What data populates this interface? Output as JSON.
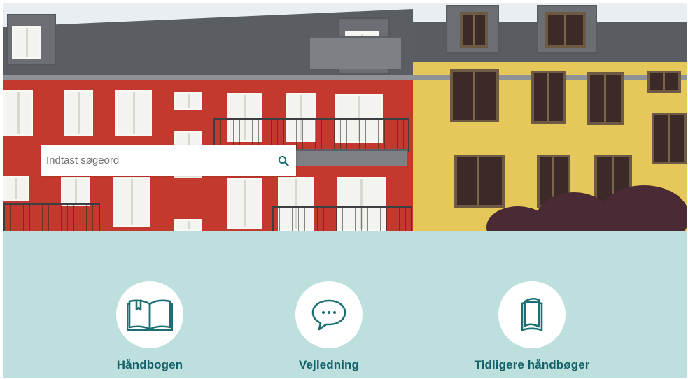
{
  "search": {
    "placeholder": "Indtast søgeord",
    "value": ""
  },
  "tiles": [
    {
      "label": "Håndbogen",
      "icon": "open-book-icon"
    },
    {
      "label": "Vejledning",
      "icon": "chat-bubble-icon"
    },
    {
      "label": "Tidligere håndbøger",
      "icon": "closed-book-icon"
    }
  ],
  "colors": {
    "teal_background": "#bde0de",
    "label_color": "#15616a",
    "icon_color": "#1b6f73"
  }
}
